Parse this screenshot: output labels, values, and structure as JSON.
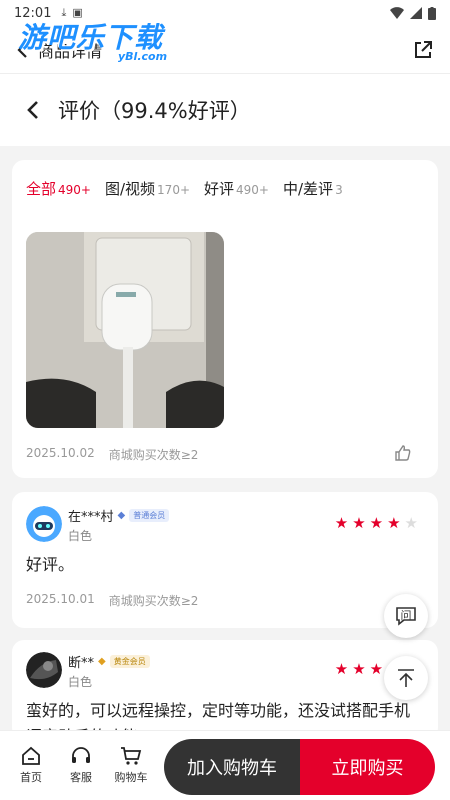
{
  "status_bar": {
    "time": "12:01"
  },
  "watermark": {
    "text": "游吧乐下载",
    "sub": "yBl.com"
  },
  "top_header": {
    "title": "商品详情"
  },
  "eval_header": {
    "title": "评价（99.4%好评）"
  },
  "tabs": [
    {
      "label": "全部",
      "count": "490+"
    },
    {
      "label": "图/视频",
      "count": "170+"
    },
    {
      "label": "好评",
      "count": "490+"
    },
    {
      "label": "中/差评",
      "count": "3"
    }
  ],
  "photo_review": {
    "date": "2025.10.02",
    "purchases": "商城购买次数≥2"
  },
  "reviews": [
    {
      "user": "在***村",
      "badge": "普通会员",
      "variant": "白色",
      "rating": 4,
      "text": "好评。",
      "date": "2025.10.01",
      "purchases": "商城购买次数≥2"
    },
    {
      "user": "断**",
      "badge": "黄金会员",
      "variant": "白色",
      "rating": 4,
      "text": "蛮好的，可以远程操控，定时等功能，还没试搭配手机语音助手的功能"
    }
  ],
  "floating": {
    "ask_label": "问"
  },
  "bottom_bar": {
    "home": "首页",
    "service": "客服",
    "cart": "购物车",
    "add_to_cart": "加入购物车",
    "buy_now": "立即购买"
  },
  "colors": {
    "accent": "#e4002b",
    "star": "#e4002b",
    "star_empty": "#dddddd"
  }
}
